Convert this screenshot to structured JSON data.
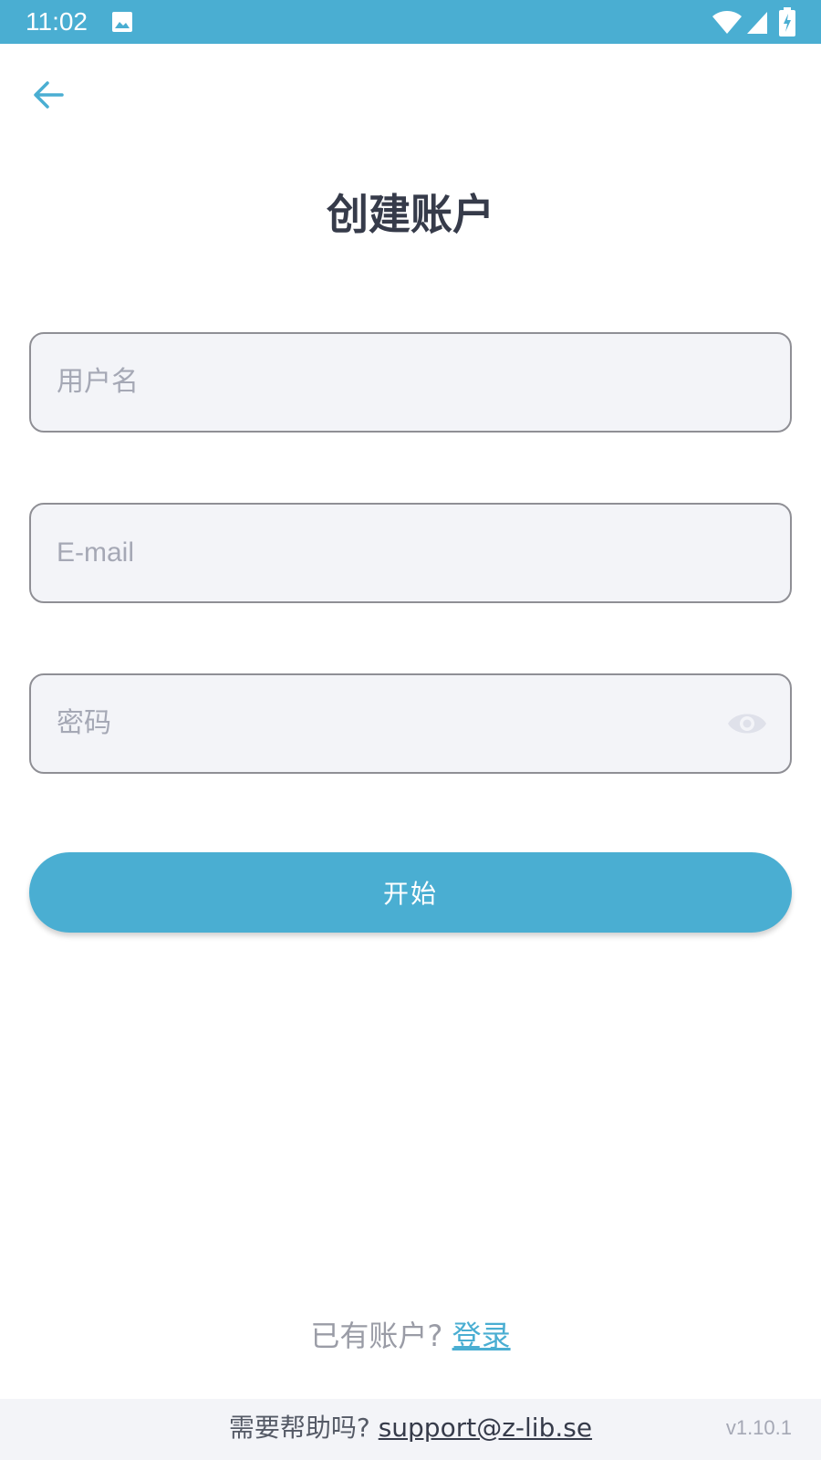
{
  "status_bar": {
    "time": "11:02",
    "background_color": "#4aaed2",
    "icons": [
      "image-icon",
      "wifi-icon",
      "signal-icon",
      "battery-charging-icon"
    ]
  },
  "header": {
    "back_icon": "arrow-left-icon"
  },
  "title": "创建账户",
  "form": {
    "username": {
      "placeholder": "用户名",
      "value": ""
    },
    "email": {
      "placeholder": "E-mail",
      "value": ""
    },
    "password": {
      "placeholder": "密码",
      "value": "",
      "toggle_icon": "eye-icon"
    }
  },
  "start_button": {
    "label": "开始",
    "color": "#4aaed2"
  },
  "login_prompt": {
    "text": "已有账户?",
    "link_label": "登录"
  },
  "footer": {
    "help_text": "需要帮助吗?",
    "support_email": "support@z-lib.se",
    "version": "v1.10.1"
  }
}
